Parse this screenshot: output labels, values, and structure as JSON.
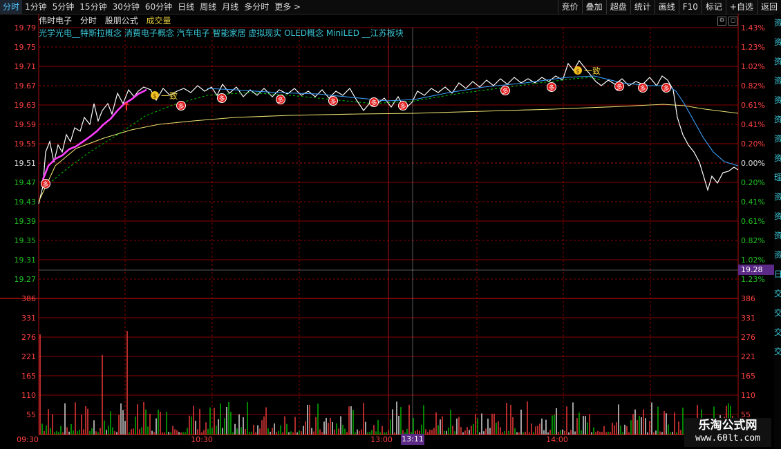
{
  "toolbar": {
    "periods": [
      {
        "label": "分时",
        "active": true
      },
      {
        "label": "1分钟"
      },
      {
        "label": "5分钟"
      },
      {
        "label": "15分钟"
      },
      {
        "label": "30分钟"
      },
      {
        "label": "60分钟"
      },
      {
        "label": "日线"
      },
      {
        "label": "周线"
      },
      {
        "label": "月线"
      },
      {
        "label": "多分时"
      },
      {
        "label": "更多 >"
      }
    ],
    "actions": [
      "竞价",
      "叠加",
      "超盘",
      "统计",
      "画线",
      "F10",
      "标记",
      "+自选",
      "返回"
    ]
  },
  "header": {
    "stock_name": "伟时电子",
    "mode": "分时",
    "formula": "股朋公式",
    "indicator": "成交量",
    "concepts": "光学光电__特斯拉概念 消费电子概念 汽车电子 智能家居 虚拟现实 OLED概念 MiniLED __江苏板块"
  },
  "price_axis": {
    "prices": [
      "19.79",
      "19.75",
      "19.71",
      "19.67",
      "19.63",
      "19.59",
      "19.55",
      "19.51",
      "19.47",
      "19.43",
      "19.39",
      "19.35",
      "19.31",
      "19.27"
    ],
    "pcts": [
      "1.43%",
      "1.23%",
      "1.02%",
      "0.82%",
      "0.61%",
      "0.41%",
      "0.20%",
      "0.00%",
      "0.20%",
      "0.41%",
      "0.61%",
      "0.82%",
      "1.02%",
      "1.23%"
    ]
  },
  "volume_axis": {
    "values": [
      "386",
      "331",
      "276",
      "221",
      "165",
      "110",
      "55"
    ]
  },
  "time_axis": {
    "labels": [
      "09:30",
      "10:30",
      "13:00",
      "14:00"
    ],
    "cursor": "13:11"
  },
  "cursor_price": "19.28",
  "markers": {
    "buy_text": "多",
    "consistent_text": "一致"
  },
  "side_strip_chars": [
    "资",
    "资",
    "资",
    "资",
    "资",
    "资",
    "资",
    "资",
    "理",
    "资",
    "资",
    "资",
    "资",
    "日",
    "交",
    "交",
    "交",
    "交"
  ],
  "watermark": {
    "title": "乐淘公式网",
    "url": "www.60lt.com"
  },
  "colors": {
    "up": "#ff4040",
    "down": "#00c000",
    "price_line": "#ffffff",
    "avg_line": "#e8e070",
    "ma_line": "#3aa0ff",
    "dash_line": "#00d000",
    "highlight": "#ff40ff",
    "grid": "#8a0000"
  }
}
